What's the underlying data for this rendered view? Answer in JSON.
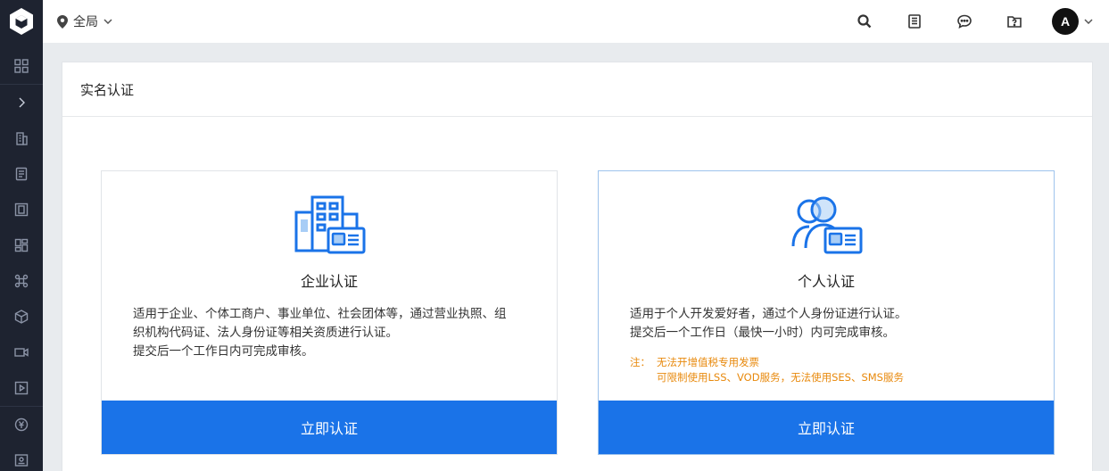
{
  "topbar": {
    "region_label": "全局",
    "avatar_initial": "A"
  },
  "sidebar": {
    "icons": [
      "grid-icon",
      "chevron-right-icon",
      "building-icon",
      "document-icon",
      "frame-icon",
      "dashboard-icon",
      "command-icon",
      "cube-icon",
      "video-icon",
      "play-icon",
      "yen-icon",
      "id-card-icon"
    ]
  },
  "page": {
    "title": "实名认证"
  },
  "cards": {
    "enterprise": {
      "title": "企业认证",
      "desc_lines": [
        "适用于企业、个体工商户、事业单位、社会团体等，通过营业执照、组",
        "织机构代码证、法人身份证等相关资质进行认证。",
        "提交后一个工作日内可完成审核。"
      ],
      "button": "立即认证"
    },
    "personal": {
      "title": "个人认证",
      "desc_lines": [
        "适用于个人开发爱好者，通过个人身份证进行认证。",
        "提交后一个工作日（最快一小时）内可完成审核。"
      ],
      "note_label": "注：",
      "note_lines": [
        "无法开增值税专用发票",
        "可限制使用LSS、VOD服务，无法使用SES、SMS服务"
      ],
      "button": "立即认证"
    }
  },
  "colors": {
    "accent": "#1a73e8",
    "sidebar_bg": "#1e2330",
    "note": "#e8890c"
  }
}
